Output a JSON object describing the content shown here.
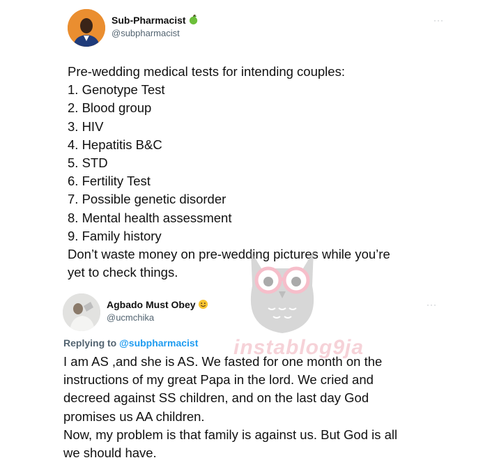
{
  "tweet1": {
    "author_name": "Sub-Pharmacist",
    "author_handle": "@subpharmacist",
    "name_emoji": "green-apple-icon",
    "lines": [
      "Pre-wedding medical tests for intending couples:",
      "1. Genotype Test",
      "2. Blood group",
      "3. HIV",
      "4. Hepatitis B&C",
      "5. STD",
      "6. Fertility Test",
      "7. Possible genetic disorder",
      "8. Mental health assessment",
      "9. Family history",
      "Don’t waste money on pre-wedding pictures while you’re",
      "yet to check things."
    ]
  },
  "tweet2": {
    "author_name": "Agbado Must Obey",
    "author_handle": "@ucmchika",
    "name_emoji": "smiling-face-icon",
    "reply_prefix": "Replying to",
    "reply_to": "@subpharmacist",
    "lines": [
      "I am AS ,and she is AS. We fasted for one month on the",
      "instructions of my great Papa in the lord. We cried and",
      "decreed against SS children, and on the last day God",
      "promises us AA children.",
      "Now, my problem is that family is against us. But God is all",
      "we should have."
    ]
  },
  "watermark": {
    "text": "instablog9ja"
  },
  "more_label": "···",
  "colors": {
    "link": "#1d9bf0",
    "muted": "#536471",
    "watermark": "#f3c4cc"
  }
}
